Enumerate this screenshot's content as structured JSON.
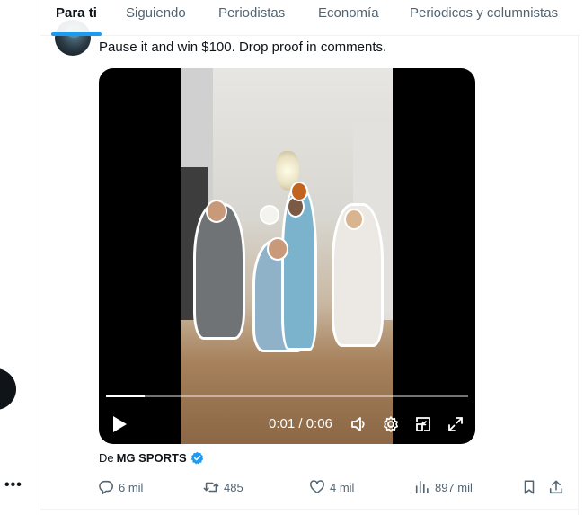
{
  "tabs": [
    {
      "label": "Para ti",
      "active": true
    },
    {
      "label": "Siguiendo",
      "active": false
    },
    {
      "label": "Periodistas",
      "active": false
    },
    {
      "label": "Economía",
      "active": false
    },
    {
      "label": "Periodicos y columnistas",
      "active": false
    }
  ],
  "tweet": {
    "text": "Pause it and win $100. Drop proof in comments.",
    "from_prefix": "De",
    "from_name": "MG SPORTS",
    "verified": true
  },
  "video": {
    "time_display": "0:01 / 0:06",
    "progress_fraction": 0.107
  },
  "actions": {
    "replies": "6 mil",
    "reposts": "485",
    "likes": "4 mil",
    "views": "897 mil"
  },
  "left_rail": {
    "more_label": "•••"
  },
  "colors": {
    "accent": "#1d9bf0",
    "text_primary": "#0f1419",
    "text_secondary": "#536471"
  }
}
